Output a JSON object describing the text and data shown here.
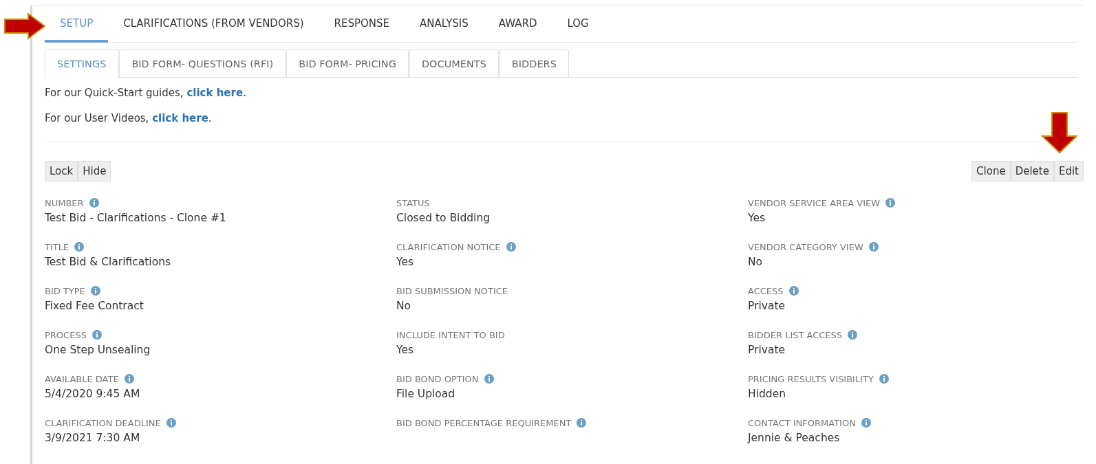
{
  "main_tabs": [
    {
      "label": "SETUP",
      "selected": true
    },
    {
      "label": "CLARIFICATIONS (FROM VENDORS)",
      "selected": false
    },
    {
      "label": "RESPONSE",
      "selected": false
    },
    {
      "label": "ANALYSIS",
      "selected": false
    },
    {
      "label": "AWARD",
      "selected": false
    },
    {
      "label": "LOG",
      "selected": false
    }
  ],
  "sub_tabs": [
    {
      "label": "SETTINGS",
      "selected": true
    },
    {
      "label": "BID FORM- QUESTIONS (RFI)",
      "selected": false
    },
    {
      "label": "BID FORM- PRICING",
      "selected": false
    },
    {
      "label": "DOCUMENTS",
      "selected": false
    },
    {
      "label": "BIDDERS",
      "selected": false
    }
  ],
  "help_lines": [
    {
      "text": "For our Quick-Start guides, ",
      "link": "click here",
      "after": "."
    },
    {
      "text": "For our User Videos, ",
      "link": "click here",
      "after": "."
    }
  ],
  "left_buttons": [
    "Lock",
    "Hide"
  ],
  "right_buttons": [
    "Clone",
    "Delete",
    "Edit"
  ],
  "columns": [
    [
      {
        "label": "NUMBER",
        "info": true,
        "value": "Test Bid - Clarifications - Clone #1"
      },
      {
        "label": "TITLE",
        "info": true,
        "value": "Test Bid & Clarifications"
      },
      {
        "label": "BID TYPE",
        "info": true,
        "value": "Fixed Fee Contract"
      },
      {
        "label": "PROCESS",
        "info": true,
        "value": "One Step Unsealing"
      },
      {
        "label": "AVAILABLE DATE",
        "info": true,
        "value": "5/4/2020 9:45 AM"
      },
      {
        "label": "CLARIFICATION DEADLINE",
        "info": true,
        "value": "3/9/2021 7:30 AM"
      }
    ],
    [
      {
        "label": "STATUS",
        "info": false,
        "value": "Closed to Bidding"
      },
      {
        "label": "CLARIFICATION NOTICE",
        "info": true,
        "value": "Yes"
      },
      {
        "label": "BID SUBMISSION NOTICE",
        "info": false,
        "value": "No"
      },
      {
        "label": "INCLUDE INTENT TO BID",
        "info": false,
        "value": "Yes"
      },
      {
        "label": "BID BOND OPTION",
        "info": true,
        "value": "File Upload"
      },
      {
        "label": "BID BOND PERCENTAGE REQUIREMENT",
        "info": true
      }
    ],
    [
      {
        "label": "VENDOR SERVICE AREA VIEW",
        "info": true,
        "value": "Yes"
      },
      {
        "label": "VENDOR CATEGORY VIEW",
        "info": true,
        "value": "No"
      },
      {
        "label": "ACCESS",
        "info": true,
        "value": "Private"
      },
      {
        "label": "BIDDER LIST ACCESS",
        "info": true,
        "value": "Private"
      },
      {
        "label": "PRICING RESULTS VISIBILITY",
        "info": true,
        "value": "Hidden"
      },
      {
        "label": "CONTACT INFORMATION",
        "info": true,
        "value": "Jennie & Peaches"
      }
    ]
  ]
}
